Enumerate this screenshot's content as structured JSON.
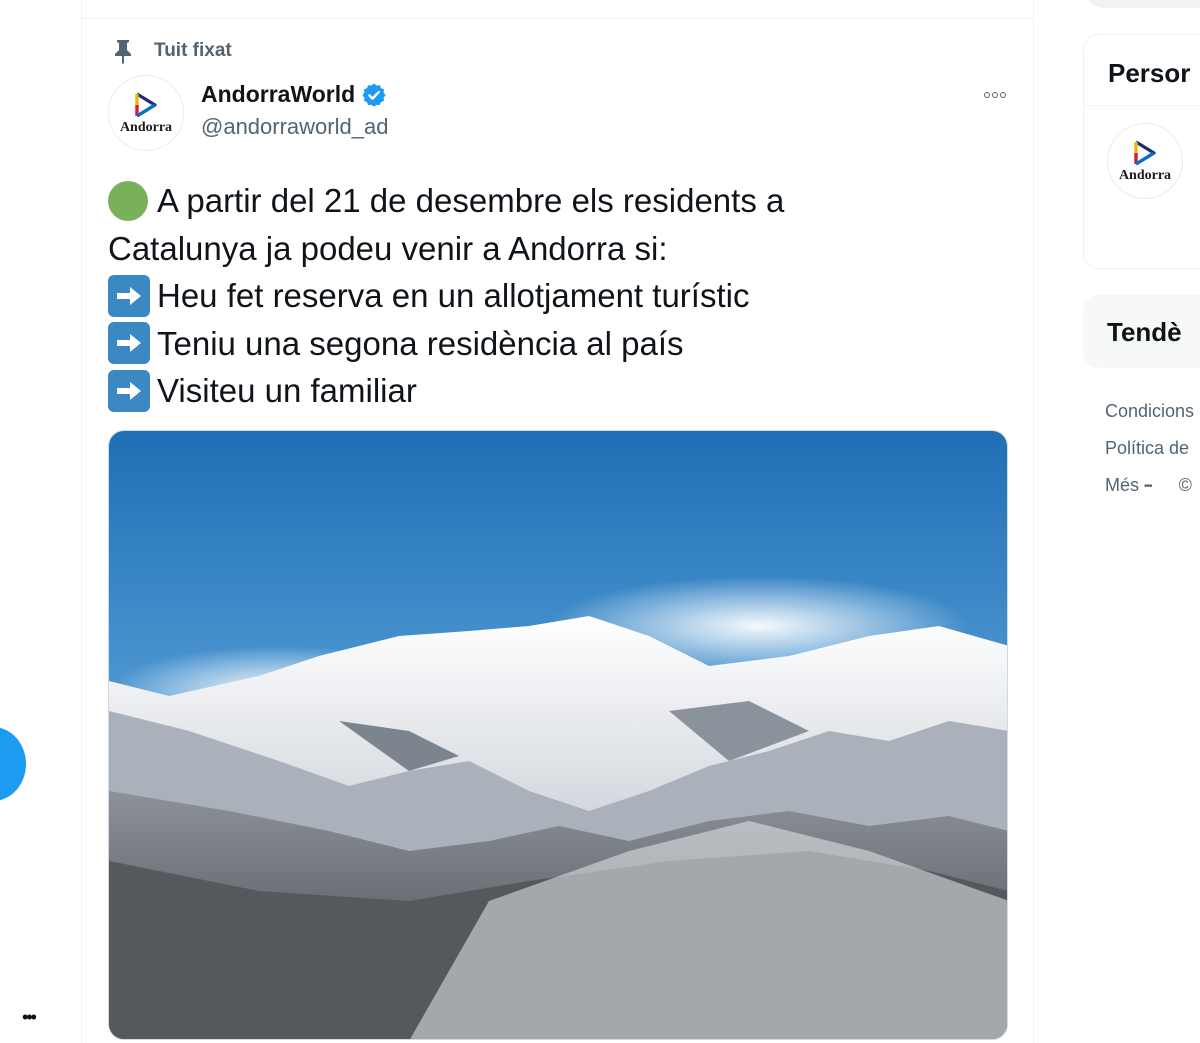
{
  "left_nav": {
    "more_label": "•••"
  },
  "tweet": {
    "pinned_label": "Tuit fixat",
    "avatar_text": "Andorra",
    "display_name": "AndorraWorld",
    "handle": "@andorraworld_ad",
    "more_label": "More",
    "lines": [
      "A partir del 21 de desembre els residents a",
      "Catalunya ja podeu venir a Andorra si:",
      "Heu fet reserva en un allotjament turístic",
      "Teniu una segona residència al país",
      "Visiteu un familiar"
    ],
    "media_icon": "snowy-mountains-photo"
  },
  "sidebar": {
    "who_to_follow_title": "Persor",
    "who_avatar_text": "Andorra",
    "trends_title": "Tendè",
    "footer": {
      "terms": "Condicions",
      "privacy": "Política de",
      "more": "Més",
      "more_dots": "•••",
      "copyright": "©"
    }
  },
  "colors": {
    "accent": "#1d9bf0",
    "secondary_text": "#536471",
    "green_circle": "#78b159",
    "arrow_box": "#3b88c3",
    "verified": "#1d9bf0"
  }
}
